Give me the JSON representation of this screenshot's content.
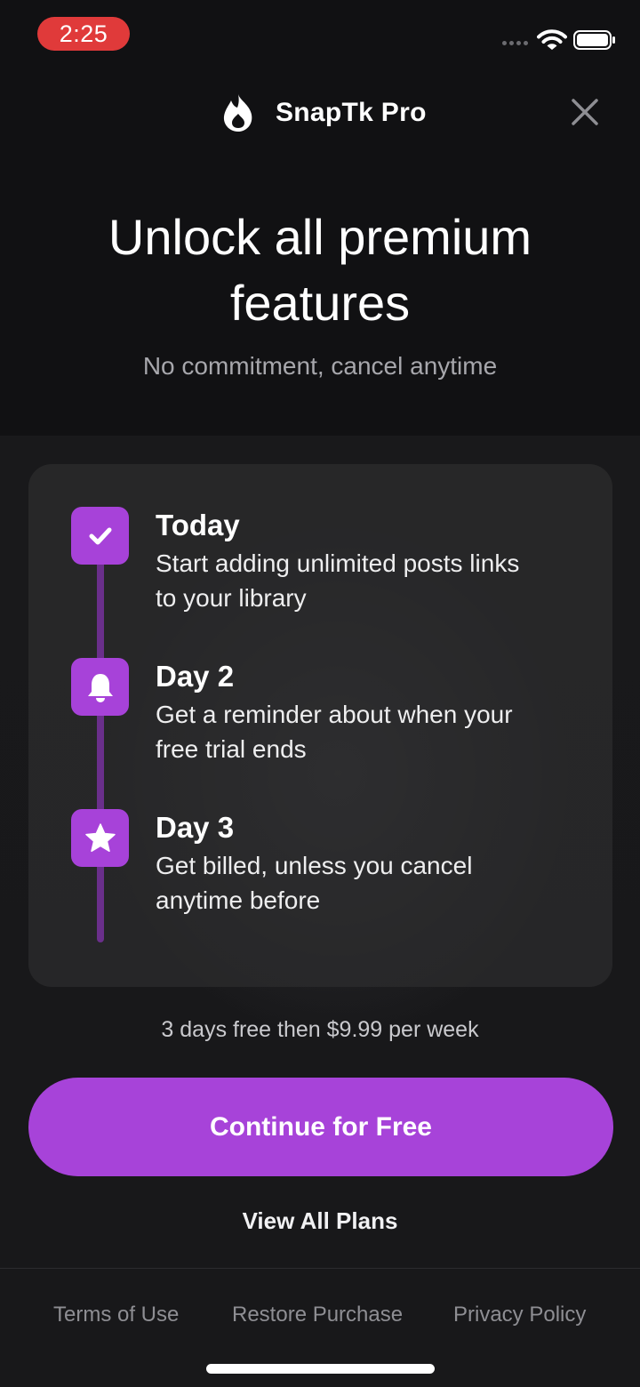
{
  "status_bar": {
    "time": "2:25"
  },
  "header": {
    "brand_name": "SnapTk Pro"
  },
  "hero": {
    "headline_line1": "Unlock all premium",
    "headline_line2": "features",
    "subhead": "No commitment, cancel anytime"
  },
  "timeline": {
    "accent_color": "#a742d9",
    "steps": [
      {
        "icon": "check-icon",
        "title": "Today",
        "desc_line1": "Start adding unlimited posts links",
        "desc_line2": "to your library"
      },
      {
        "icon": "bell-icon",
        "title": "Day 2",
        "desc_line1": "Get a reminder about when your",
        "desc_line2": "free trial ends"
      },
      {
        "icon": "star-icon",
        "title": "Day 3",
        "desc_line1": "Get billed, unless you cancel",
        "desc_line2": "anytime before"
      }
    ]
  },
  "pricing": {
    "note": "3 days free then $9.99 per week"
  },
  "actions": {
    "cta_label": "Continue for Free",
    "view_plans_label": "View All Plans"
  },
  "footer": {
    "terms": "Terms of Use",
    "restore": "Restore Purchase",
    "privacy": "Privacy Policy"
  }
}
